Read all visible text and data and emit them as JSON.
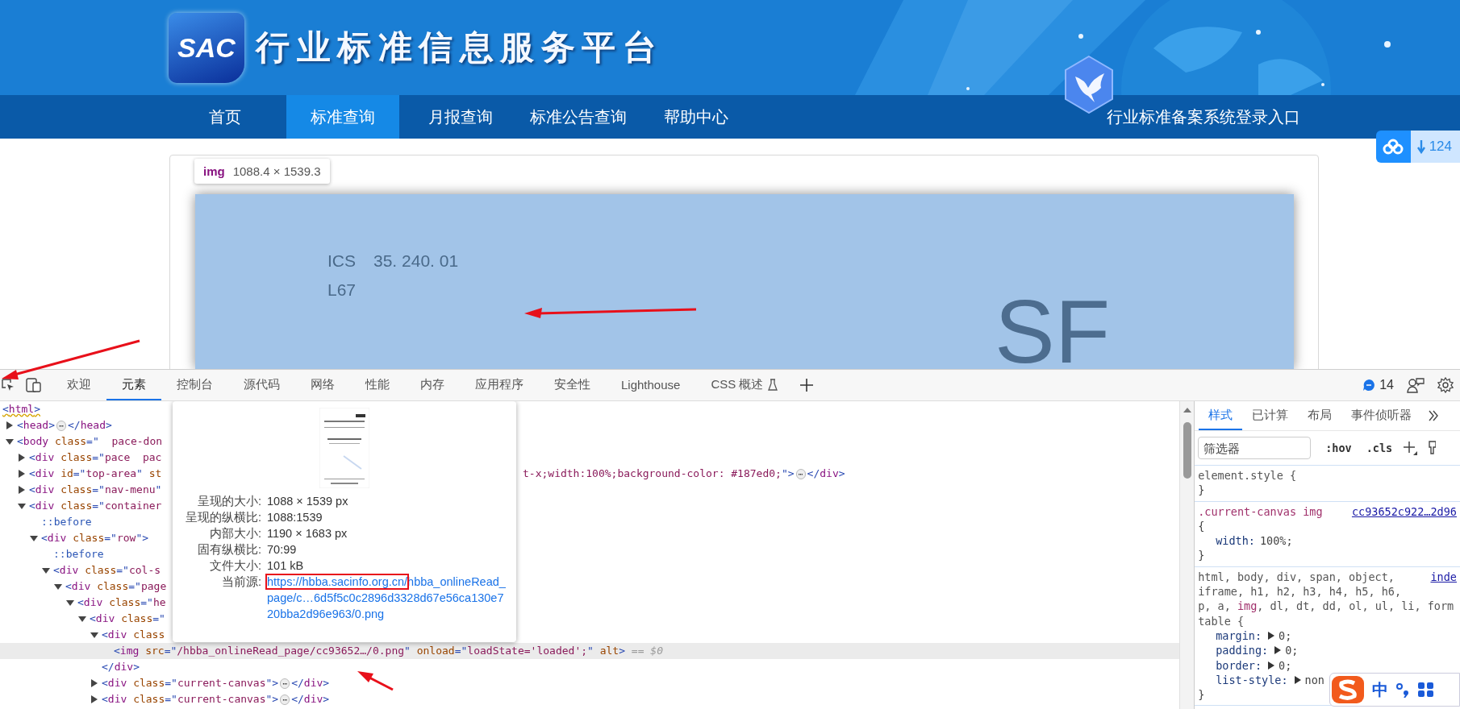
{
  "site": {
    "logo": "SAC",
    "title": "行业标准信息服务平台",
    "nav": [
      {
        "label": "首页",
        "selected": false
      },
      {
        "label": "标准查询",
        "selected": true
      },
      {
        "label": "月报查询",
        "selected": false
      },
      {
        "label": "标准公告查询",
        "selected": false
      },
      {
        "label": "帮助中心",
        "selected": false
      }
    ],
    "login_link": "行业标准备案系统登录入口",
    "download_count": "124",
    "element_tooltip": {
      "tag": "img",
      "size": "1088.4 × 1539.3"
    },
    "document": {
      "ics_label": "ICS",
      "ics_code": "35. 240. 01",
      "ccs_code": "L67",
      "mark": "SF"
    }
  },
  "devtools": {
    "tabs": [
      {
        "label": "欢迎",
        "selected": false,
        "experimental": false
      },
      {
        "label": "元素",
        "selected": true,
        "experimental": false
      },
      {
        "label": "控制台",
        "selected": false,
        "experimental": false
      },
      {
        "label": "源代码",
        "selected": false,
        "experimental": false
      },
      {
        "label": "网络",
        "selected": false,
        "experimental": false
      },
      {
        "label": "性能",
        "selected": false,
        "experimental": false
      },
      {
        "label": "内存",
        "selected": false,
        "experimental": false
      },
      {
        "label": "应用程序",
        "selected": false,
        "experimental": false
      },
      {
        "label": "安全性",
        "selected": false,
        "experimental": false
      },
      {
        "label": "Lighthouse",
        "selected": false,
        "experimental": false
      },
      {
        "label": "CSS 概述",
        "selected": false,
        "experimental": true
      }
    ],
    "issues_count": "14",
    "dom_tree": {
      "flagged": true,
      "selected": false,
      "left": [
        {
          "kind": "code",
          "tokens": [
            {
              "kind": "punct",
              "text": "<"
            },
            {
              "kind": "tag",
              "text": "html"
            },
            {
              "kind": "punct",
              "text": ">"
            }
          ]
        }
      ],
      "children": [
        {
          "expanded": false,
          "selected": false,
          "left": [
            {
              "kind": "code",
              "tokens": [
                {
                  "kind": "punct",
                  "text": "<"
                },
                {
                  "kind": "tag",
                  "text": "head"
                },
                {
                  "kind": "punct",
                  "text": ">"
                }
              ]
            },
            {
              "kind": "badge",
              "text": "⋯"
            },
            {
              "kind": "code",
              "tokens": [
                {
                  "kind": "punct",
                  "text": "</"
                },
                {
                  "kind": "tag",
                  "text": "head"
                },
                {
                  "kind": "punct",
                  "text": ">"
                }
              ]
            }
          ]
        },
        {
          "expanded": true,
          "selected": false,
          "left": [
            {
              "kind": "code",
              "tokens": [
                {
                  "kind": "punct",
                  "text": "<"
                },
                {
                  "kind": "tag",
                  "text": "body"
                },
                {
                  "kind": "attr",
                  "text": " class"
                },
                {
                  "kind": "punct",
                  "text": "=\""
                },
                {
                  "kind": "value",
                  "text": "  pace-don"
                }
              ]
            }
          ],
          "children": [
            {
              "expanded": false,
              "selected": false,
              "left": [
                {
                  "kind": "code",
                  "tokens": [
                    {
                      "kind": "punct",
                      "text": "<"
                    },
                    {
                      "kind": "tag",
                      "text": "div"
                    },
                    {
                      "kind": "attr",
                      "text": " class"
                    },
                    {
                      "kind": "punct",
                      "text": "=\""
                    },
                    {
                      "kind": "value",
                      "text": "pace  pac"
                    }
                  ]
                }
              ]
            },
            {
              "expanded": false,
              "selected": false,
              "left": [
                {
                  "kind": "code",
                  "tokens": [
                    {
                      "kind": "punct",
                      "text": "<"
                    },
                    {
                      "kind": "tag",
                      "text": "div"
                    },
                    {
                      "kind": "attr",
                      "text": " id"
                    },
                    {
                      "kind": "punct",
                      "text": "=\""
                    },
                    {
                      "kind": "value",
                      "text": "top-area"
                    },
                    {
                      "kind": "punct",
                      "text": "\""
                    },
                    {
                      "kind": "attr",
                      "text": " st"
                    }
                  ]
                }
              ],
              "right": [
                {
                  "kind": "code",
                  "tokens": [
                    {
                      "kind": "value",
                      "text": "t-x;width:100%;background-color: #187ed0;"
                    },
                    {
                      "kind": "punct",
                      "text": "\">"
                    }
                  ]
                },
                {
                  "kind": "badge",
                  "text": "⋯"
                },
                {
                  "kind": "code",
                  "tokens": [
                    {
                      "kind": "punct",
                      "text": "</"
                    },
                    {
                      "kind": "tag",
                      "text": "div"
                    },
                    {
                      "kind": "punct",
                      "text": ">"
                    }
                  ]
                }
              ]
            },
            {
              "expanded": false,
              "selected": false,
              "left": [
                {
                  "kind": "code",
                  "tokens": [
                    {
                      "kind": "punct",
                      "text": "<"
                    },
                    {
                      "kind": "tag",
                      "text": "div"
                    },
                    {
                      "kind": "attr",
                      "text": " class"
                    },
                    {
                      "kind": "punct",
                      "text": "=\""
                    },
                    {
                      "kind": "value",
                      "text": "nav-menu"
                    },
                    {
                      "kind": "punct",
                      "text": "\""
                    }
                  ]
                }
              ]
            },
            {
              "expanded": true,
              "selected": false,
              "left": [
                {
                  "kind": "code",
                  "tokens": [
                    {
                      "kind": "punct",
                      "text": "<"
                    },
                    {
                      "kind": "tag",
                      "text": "div"
                    },
                    {
                      "kind": "attr",
                      "text": " class"
                    },
                    {
                      "kind": "punct",
                      "text": "=\""
                    },
                    {
                      "kind": "value",
                      "text": "container"
                    }
                  ]
                }
              ],
              "children": [
                {
                  "selected": false,
                  "left": [
                    {
                      "kind": "code",
                      "tokens": [
                        {
                          "kind": "pseudo",
                          "text": "::before"
                        }
                      ]
                    }
                  ]
                },
                {
                  "expanded": true,
                  "selected": false,
                  "left": [
                    {
                      "kind": "code",
                      "tokens": [
                        {
                          "kind": "punct",
                          "text": "<"
                        },
                        {
                          "kind": "tag",
                          "text": "div"
                        },
                        {
                          "kind": "attr",
                          "text": " class"
                        },
                        {
                          "kind": "punct",
                          "text": "=\""
                        },
                        {
                          "kind": "value",
                          "text": "row"
                        },
                        {
                          "kind": "punct",
                          "text": "\">"
                        }
                      ]
                    }
                  ],
                  "children": [
                    {
                      "selected": false,
                      "left": [
                        {
                          "kind": "code",
                          "tokens": [
                            {
                              "kind": "pseudo",
                              "text": "::before"
                            }
                          ]
                        }
                      ]
                    },
                    {
                      "expanded": true,
                      "selected": false,
                      "left": [
                        {
                          "kind": "code",
                          "tokens": [
                            {
                              "kind": "punct",
                              "text": "<"
                            },
                            {
                              "kind": "tag",
                              "text": "div"
                            },
                            {
                              "kind": "attr",
                              "text": " class"
                            },
                            {
                              "kind": "punct",
                              "text": "=\""
                            },
                            {
                              "kind": "value",
                              "text": "col-s"
                            }
                          ]
                        }
                      ],
                      "children": [
                        {
                          "expanded": true,
                          "selected": false,
                          "left": [
                            {
                              "kind": "code",
                              "tokens": [
                                {
                                  "kind": "punct",
                                  "text": "<"
                                },
                                {
                                  "kind": "tag",
                                  "text": "div"
                                },
                                {
                                  "kind": "attr",
                                  "text": " class"
                                },
                                {
                                  "kind": "punct",
                                  "text": "=\""
                                },
                                {
                                  "kind": "value",
                                  "text": "page"
                                }
                              ]
                            }
                          ],
                          "children": [
                            {
                              "expanded": true,
                              "selected": false,
                              "left": [
                                {
                                  "kind": "code",
                                  "tokens": [
                                    {
                                      "kind": "punct",
                                      "text": "<"
                                    },
                                    {
                                      "kind": "tag",
                                      "text": "div"
                                    },
                                    {
                                      "kind": "attr",
                                      "text": " class"
                                    },
                                    {
                                      "kind": "punct",
                                      "text": "=\""
                                    },
                                    {
                                      "kind": "value",
                                      "text": "he"
                                    }
                                  ]
                                }
                              ],
                              "children": [
                                {
                                  "expanded": true,
                                  "selected": false,
                                  "left": [
                                    {
                                      "kind": "code",
                                      "tokens": [
                                        {
                                          "kind": "punct",
                                          "text": "<"
                                        },
                                        {
                                          "kind": "tag",
                                          "text": "div"
                                        },
                                        {
                                          "kind": "attr",
                                          "text": " class"
                                        },
                                        {
                                          "kind": "punct",
                                          "text": "=\""
                                        }
                                      ]
                                    }
                                  ],
                                  "children": [
                                    {
                                      "expanded": true,
                                      "selected": false,
                                      "left": [
                                        {
                                          "kind": "code",
                                          "tokens": [
                                            {
                                              "kind": "punct",
                                              "text": "<"
                                            },
                                            {
                                              "kind": "tag",
                                              "text": "div"
                                            },
                                            {
                                              "kind": "attr",
                                              "text": " class"
                                            }
                                          ]
                                        }
                                      ],
                                      "children": [
                                        {
                                          "selected": true,
                                          "left": [
                                            {
                                              "kind": "code",
                                              "tokens": [
                                                {
                                                  "kind": "punct",
                                                  "text": "<"
                                                },
                                                {
                                                  "kind": "tag",
                                                  "text": "img"
                                                },
                                                {
                                                  "kind": "attr",
                                                  "text": " src"
                                                },
                                                {
                                                  "kind": "punct",
                                                  "text": "=\""
                                                },
                                                {
                                                  "kind": "value",
                                                  "text": "/hbba_onlineRead_page/cc93652…/0.png"
                                                },
                                                {
                                                  "kind": "punct",
                                                  "text": "\""
                                                },
                                                {
                                                  "kind": "attr",
                                                  "text": " onload"
                                                },
                                                {
                                                  "kind": "punct",
                                                  "text": "=\""
                                                },
                                                {
                                                  "kind": "value",
                                                  "text": "loadState='loaded';"
                                                },
                                                {
                                                  "kind": "punct",
                                                  "text": "\""
                                                },
                                                {
                                                  "kind": "attr",
                                                  "text": " alt"
                                                },
                                                {
                                                  "kind": "punct",
                                                  "text": ">"
                                                },
                                                {
                                                  "kind": "note",
                                                  "text": " == $0"
                                                }
                                              ]
                                            }
                                          ]
                                        }
                                      ]
                                    },
                                    {
                                      "selected": false,
                                      "left": [
                                        {
                                          "kind": "code",
                                          "tokens": [
                                            {
                                              "kind": "punct",
                                              "text": "</"
                                            },
                                            {
                                              "kind": "tag",
                                              "text": "div"
                                            },
                                            {
                                              "kind": "punct",
                                              "text": ">"
                                            }
                                          ]
                                        }
                                      ]
                                    },
                                    {
                                      "expanded": false,
                                      "selected": false,
                                      "left": [
                                        {
                                          "kind": "code",
                                          "tokens": [
                                            {
                                              "kind": "punct",
                                              "text": "<"
                                            },
                                            {
                                              "kind": "tag",
                                              "text": "div"
                                            },
                                            {
                                              "kind": "attr",
                                              "text": " class"
                                            },
                                            {
                                              "kind": "punct",
                                              "text": "=\""
                                            },
                                            {
                                              "kind": "value",
                                              "text": "current-canvas"
                                            },
                                            {
                                              "kind": "punct",
                                              "text": "\">"
                                            }
                                          ]
                                        },
                                        {
                                          "kind": "badge",
                                          "text": "⋯"
                                        },
                                        {
                                          "kind": "code",
                                          "tokens": [
                                            {
                                              "kind": "punct",
                                              "text": "</"
                                            },
                                            {
                                              "kind": "tag",
                                              "text": "div"
                                            },
                                            {
                                              "kind": "punct",
                                              "text": ">"
                                            }
                                          ]
                                        }
                                      ]
                                    },
                                    {
                                      "expanded": false,
                                      "selected": false,
                                      "left": [
                                        {
                                          "kind": "code",
                                          "tokens": [
                                            {
                                              "kind": "punct",
                                              "text": "<"
                                            },
                                            {
                                              "kind": "tag",
                                              "text": "div"
                                            },
                                            {
                                              "kind": "attr",
                                              "text": " class"
                                            },
                                            {
                                              "kind": "punct",
                                              "text": "=\""
                                            },
                                            {
                                              "kind": "value",
                                              "text": "current-canvas"
                                            },
                                            {
                                              "kind": "punct",
                                              "text": "\">"
                                            }
                                          ]
                                        },
                                        {
                                          "kind": "badge",
                                          "text": "⋯"
                                        },
                                        {
                                          "kind": "code",
                                          "tokens": [
                                            {
                                              "kind": "punct",
                                              "text": "</"
                                            },
                                            {
                                              "kind": "tag",
                                              "text": "div"
                                            },
                                            {
                                              "kind": "punct",
                                              "text": ">"
                                            }
                                          ]
                                        }
                                      ]
                                    }
                                  ]
                                }
                              ]
                            }
                          ]
                        }
                      ]
                    }
                  ]
                }
              ]
            }
          ]
        }
      ]
    },
    "image_preview": {
      "rows": [
        {
          "label": "呈现的大小:",
          "value": "1088 × 1539 px"
        },
        {
          "label": "呈现的纵横比:",
          "value": "1088:1539"
        },
        {
          "label": "内部大小:",
          "value": "1190 × 1683 px"
        },
        {
          "label": "固有纵横比:",
          "value": "70:99"
        },
        {
          "label": "文件大小:",
          "value": "101 kB"
        }
      ],
      "source_label": "当前源:",
      "source_link": {
        "boxed": "https://hbba.sacinfo.org.cn/",
        "rest": "hbba_onlineRead_page/c…6d5f5c0c2896d3328d67e56ca130e720bba2d96e963/0.png"
      }
    },
    "styles": {
      "tabs": [
        {
          "label": "样式",
          "selected": true
        },
        {
          "label": "已计算",
          "selected": false
        },
        {
          "label": "布局",
          "selected": false
        },
        {
          "label": "事件侦听器",
          "selected": false
        }
      ],
      "filter_placeholder": "筛选器",
      "toggles": [
        ":hov",
        ".cls"
      ],
      "rules": [
        {
          "lines": [
            {
              "kind": "selector",
              "tokens": [
                {
                  "text": "element.style {",
                  "matched": false
                }
              ]
            },
            {
              "kind": "brace",
              "text": "}"
            }
          ]
        },
        {
          "lines": [
            {
              "kind": "selector",
              "tokens": [
                {
                  "text": ".current-canvas img",
                  "matched": true
                }
              ],
              "source": "cc93652c922…2d96"
            },
            {
              "kind": "brace",
              "text": "{"
            },
            {
              "kind": "decl",
              "name": "width:",
              "value": "100%;",
              "expandable": false
            },
            {
              "kind": "brace",
              "text": "}"
            }
          ]
        },
        {
          "lines": [
            {
              "kind": "selector",
              "tokens": [
                {
                  "text": "html, body, div, span, object,",
                  "matched": false
                }
              ],
              "source": "inde"
            },
            {
              "kind": "selector",
              "tokens": [
                {
                  "text": "iframe, h1, h2, h3, h4, h5, h6,",
                  "matched": false
                }
              ]
            },
            {
              "kind": "selector",
              "tokens": [
                {
                  "text": "p, a, ",
                  "matched": false
                },
                {
                  "text": "img",
                  "matched": true
                },
                {
                  "text": ", dl, dt, dd, ol, ul, li, form",
                  "matched": false
                }
              ]
            },
            {
              "kind": "selector",
              "tokens": [
                {
                  "text": "table {",
                  "matched": false
                }
              ]
            },
            {
              "kind": "decl",
              "name": "margin:",
              "value": "0;",
              "expandable": true
            },
            {
              "kind": "decl",
              "name": "padding:",
              "value": "0;",
              "expandable": true
            },
            {
              "kind": "decl",
              "name": "border:",
              "value": "0;",
              "expandable": true
            },
            {
              "kind": "decl",
              "name": "list-style:",
              "value": "non",
              "expandable": true
            },
            {
              "kind": "brace",
              "text": "}"
            }
          ]
        }
      ]
    }
  },
  "ime_bar": {
    "mode": "中"
  }
}
